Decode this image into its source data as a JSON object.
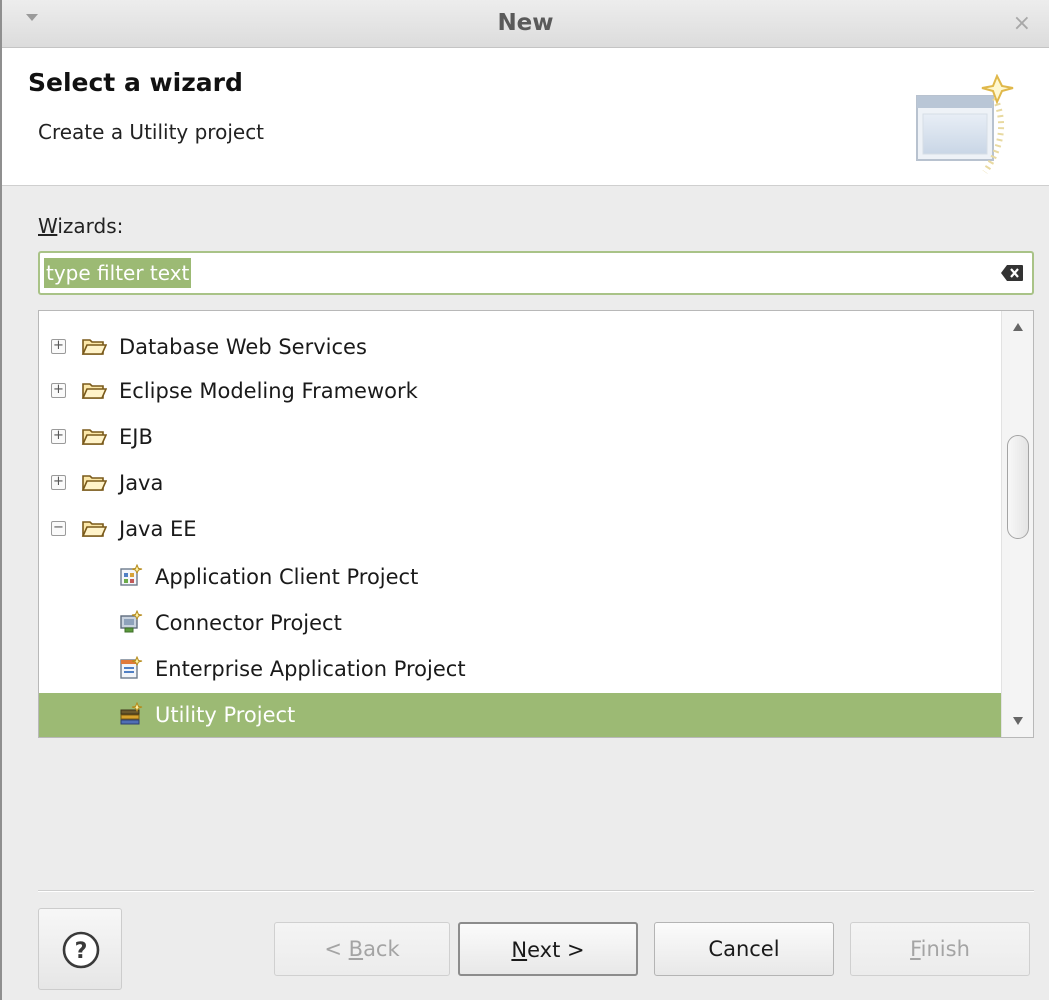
{
  "window": {
    "title": "New",
    "close_glyph": "×"
  },
  "header": {
    "title": "Select a wizard",
    "description": "Create a Utility project"
  },
  "wizards_label": {
    "mnemonic": "W",
    "rest": "izards:"
  },
  "filter": {
    "value": "type filter text",
    "placeholder": "type filter text"
  },
  "tree": {
    "items": [
      {
        "label": "Database Web Services",
        "expander": "+",
        "icon": "folder-icon"
      },
      {
        "label": "Eclipse Modeling Framework",
        "expander": "+",
        "icon": "folder-icon"
      },
      {
        "label": "EJB",
        "expander": "+",
        "icon": "folder-icon"
      },
      {
        "label": "Java",
        "expander": "+",
        "icon": "folder-icon"
      },
      {
        "label": "Java EE",
        "expander": "−",
        "icon": "folder-icon"
      },
      {
        "label": "Application Client Project",
        "icon": "application-client-project-icon"
      },
      {
        "label": "Connector Project",
        "icon": "connector-project-icon"
      },
      {
        "label": "Enterprise Application Project",
        "icon": "enterprise-application-project-icon"
      },
      {
        "label": "Utility Project",
        "icon": "utility-project-icon",
        "selected": true
      }
    ]
  },
  "buttons": {
    "help": "?",
    "back": {
      "prefix": "< ",
      "mnemonic": "B",
      "rest": "ack"
    },
    "next": {
      "mnemonic": "N",
      "rest": "ext >"
    },
    "cancel": "Cancel",
    "finish": {
      "mnemonic": "F",
      "rest": "inish"
    }
  },
  "colors": {
    "selection": "#9cba74",
    "filter_border": "#a9c387"
  }
}
